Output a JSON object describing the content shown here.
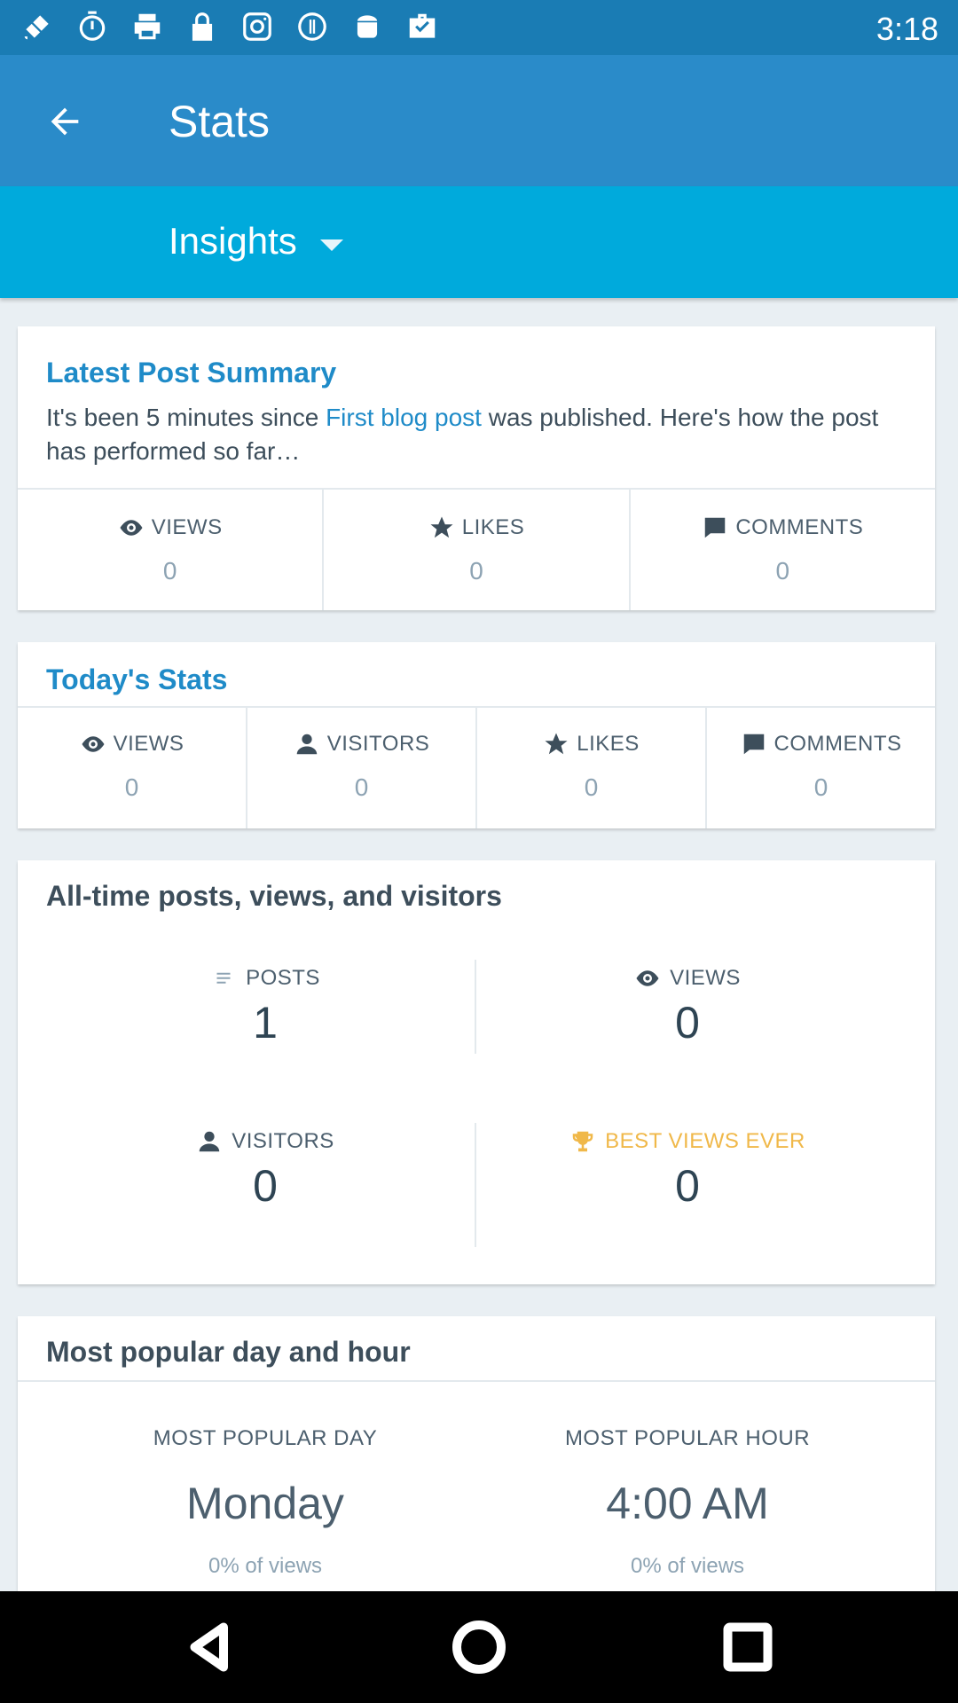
{
  "status_bar": {
    "time": "3:18",
    "icons": [
      "satellite-icon",
      "timer-icon",
      "printer-icon",
      "lock-icon",
      "instagram-icon",
      "info-circle-icon",
      "android-icon",
      "briefcase-check-icon"
    ]
  },
  "app_bar": {
    "title": "Stats"
  },
  "insights": {
    "label": "Insights"
  },
  "latest_post": {
    "title": "Latest Post Summary",
    "text_before": "It's been 5 minutes since ",
    "link": "First blog post",
    "text_after": " was published. Here's how the post has performed so far…",
    "stats": [
      {
        "label": "VIEWS",
        "value": "0",
        "icon": "eye-icon"
      },
      {
        "label": "LIKES",
        "value": "0",
        "icon": "star-icon"
      },
      {
        "label": "COMMENTS",
        "value": "0",
        "icon": "comment-icon"
      }
    ]
  },
  "today": {
    "title": "Today's Stats",
    "stats": [
      {
        "label": "VIEWS",
        "value": "0",
        "icon": "eye-icon"
      },
      {
        "label": "VISITORS",
        "value": "0",
        "icon": "person-icon"
      },
      {
        "label": "LIKES",
        "value": "0",
        "icon": "star-icon"
      },
      {
        "label": "COMMENTS",
        "value": "0",
        "icon": "comment-icon"
      }
    ]
  },
  "all_time": {
    "title": "All-time posts, views, and visitors",
    "posts": {
      "label": "POSTS",
      "value": "1",
      "icon": "posts-icon"
    },
    "views": {
      "label": "VIEWS",
      "value": "0",
      "icon": "eye-icon"
    },
    "visitors": {
      "label": "VISITORS",
      "value": "0",
      "icon": "person-icon"
    },
    "best": {
      "label": "BEST VIEWS EVER",
      "value": "0",
      "icon": "trophy-icon",
      "color": "#f0b849"
    }
  },
  "popular": {
    "title": "Most popular day and hour",
    "day": {
      "label": "MOST POPULAR DAY",
      "value": "Monday",
      "sub": "0% of views"
    },
    "hour": {
      "label": "MOST POPULAR HOUR",
      "value": "4:00 AM",
      "sub": "0% of views"
    }
  },
  "colors": {
    "status_bar": "#1a7cb4",
    "app_bar": "#2a8bc9",
    "insights_bar": "#00aadc",
    "link_blue": "#1f8bc8",
    "gold": "#f0b849"
  }
}
